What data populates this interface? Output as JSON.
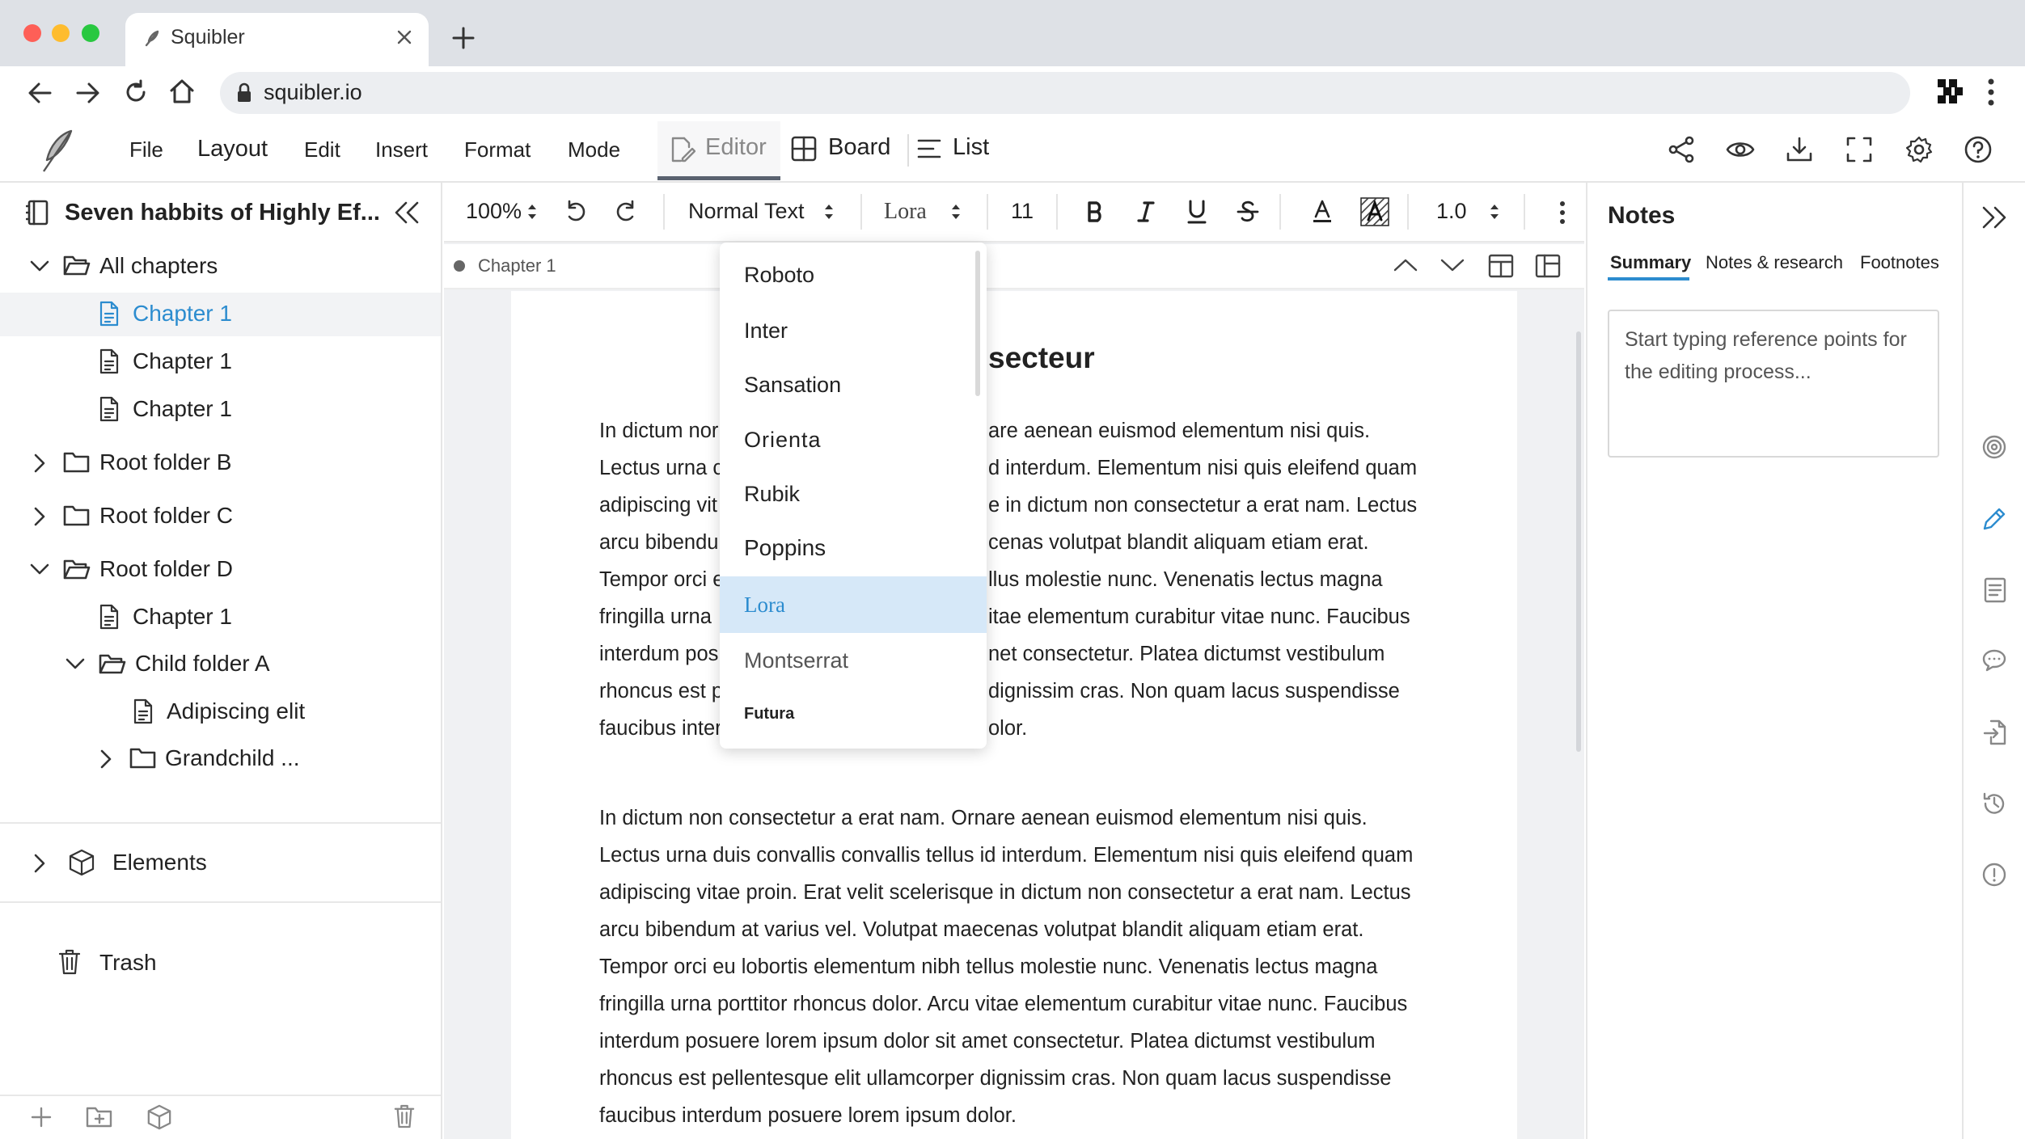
{
  "browser": {
    "tab_title": "Squibler",
    "url": "squibler.io",
    "traffic_lights": [
      "#fe5f57",
      "#febc2e",
      "#28c840"
    ]
  },
  "menu": {
    "file": "File",
    "layout": "Layout",
    "edit": "Edit",
    "insert": "Insert",
    "format": "Format",
    "mode": "Mode"
  },
  "views": {
    "editor": "Editor",
    "board": "Board",
    "list": "List"
  },
  "sidebar": {
    "project_title": "Seven habbits of Highly Ef...",
    "tree": [
      {
        "label": "All chapters"
      },
      {
        "label": "Chapter 1"
      },
      {
        "label": "Chapter 1"
      },
      {
        "label": "Chapter 1"
      },
      {
        "label": "Root folder B"
      },
      {
        "label": "Root folder C"
      },
      {
        "label": "Root folder D"
      },
      {
        "label": "Chapter 1"
      },
      {
        "label": "Child folder A"
      },
      {
        "label": "Adipiscing elit"
      },
      {
        "label": "Grandchild ..."
      }
    ],
    "elements_label": "Elements",
    "trash_label": "Trash"
  },
  "toolbar": {
    "zoom": "100%",
    "style": "Normal Text",
    "font": "Lora",
    "size": "11",
    "line_spacing": "1.0"
  },
  "breadcrumb": {
    "current": "Chapter 1"
  },
  "font_dropdown": {
    "options": [
      "Roboto",
      "Inter",
      "Sansation",
      "Orienta",
      "Rubik",
      "Poppins",
      "Lora",
      "Montserrat",
      "Futura"
    ],
    "selected": "Lora"
  },
  "document": {
    "heading_visible": "secteur",
    "para1_lines": [
      "In dictum nor",
      "Lectus urna c",
      "adipiscing vit",
      "arcu bibendu",
      "Tempor orci e",
      "fringilla urna",
      "interdum pos",
      "rhoncus est p",
      "faucibus inter"
    ],
    "para1_right_lines": [
      "are aenean euismod elementum nisi quis.",
      "d interdum. Elementum nisi quis eleifend quam",
      "e in dictum non consectetur a erat nam. Lectus",
      "cenas volutpat blandit aliquam etiam erat.",
      "llus molestie nunc. Venenatis lectus magna",
      "itae elementum curabitur vitae nunc. Faucibus",
      "net consectetur. Platea dictumst vestibulum",
      "dignissim cras. Non quam lacus suspendisse",
      "olor."
    ],
    "para2_lines": [
      "In dictum non consectetur a erat nam. Ornare aenean euismod elementum nisi quis.",
      "Lectus urna duis convallis convallis tellus id interdum. Elementum nisi quis eleifend quam",
      "adipiscing vitae proin. Erat velit scelerisque in dictum non consectetur a erat nam. Lectus",
      "arcu bibendum at varius vel. Volutpat maecenas volutpat blandit aliquam etiam erat.",
      "Tempor orci eu lobortis elementum nibh tellus molestie nunc. Venenatis lectus magna",
      "fringilla urna porttitor rhoncus dolor. Arcu vitae elementum curabitur vitae nunc. Faucibus",
      "interdum posuere lorem ipsum dolor sit amet consectetur. Platea dictumst vestibulum",
      "rhoncus est pellentesque elit ullamcorper dignissim cras. Non quam lacus suspendisse",
      "faucibus interdum posuere lorem ipsum dolor."
    ]
  },
  "notes": {
    "title": "Notes",
    "tabs": [
      "Summary",
      "Notes & research",
      "Footnotes"
    ],
    "active_tab": "Summary",
    "placeholder": "Start typing reference points for the editing process..."
  },
  "colors": {
    "accent": "#2c8ccf",
    "selected_row_bg": "#f2f3f5",
    "dropdown_selected_bg": "#d6e8f8"
  }
}
